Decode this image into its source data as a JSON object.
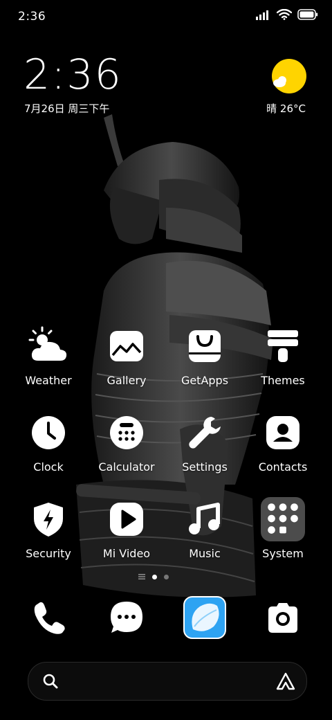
{
  "status_bar": {
    "time": "2:36",
    "icons": [
      "cellular-signal-icon",
      "wifi-icon",
      "battery-icon"
    ]
  },
  "clock_widget": {
    "time": "2:36",
    "date": "7月26日 周三下午"
  },
  "weather_widget": {
    "condition_icon": "sunny-icon",
    "text": "晴 26°C",
    "sun_color": "#FFD400"
  },
  "apps": [
    {
      "label": "Weather",
      "icon": "weather-icon"
    },
    {
      "label": "Gallery",
      "icon": "gallery-icon"
    },
    {
      "label": "GetApps",
      "icon": "getapps-icon"
    },
    {
      "label": "Themes",
      "icon": "themes-icon"
    },
    {
      "label": "Clock",
      "icon": "clock-icon"
    },
    {
      "label": "Calculator",
      "icon": "calculator-icon"
    },
    {
      "label": "Settings",
      "icon": "settings-icon"
    },
    {
      "label": "Contacts",
      "icon": "contacts-icon"
    },
    {
      "label": "Security",
      "icon": "security-icon"
    },
    {
      "label": "Mi Video",
      "icon": "mi-video-icon"
    },
    {
      "label": "Music",
      "icon": "music-icon"
    },
    {
      "label": "System",
      "icon": "system-folder-icon"
    }
  ],
  "page_indicator": {
    "pages": 2,
    "current": 1
  },
  "dock": [
    {
      "icon": "phone-icon"
    },
    {
      "icon": "messages-icon"
    },
    {
      "icon": "browser-icon",
      "color": "#2EA3F2"
    },
    {
      "icon": "camera-icon"
    }
  ],
  "search_bar": {
    "left_icon": "search-icon",
    "right_icon": "assistant-icon"
  }
}
